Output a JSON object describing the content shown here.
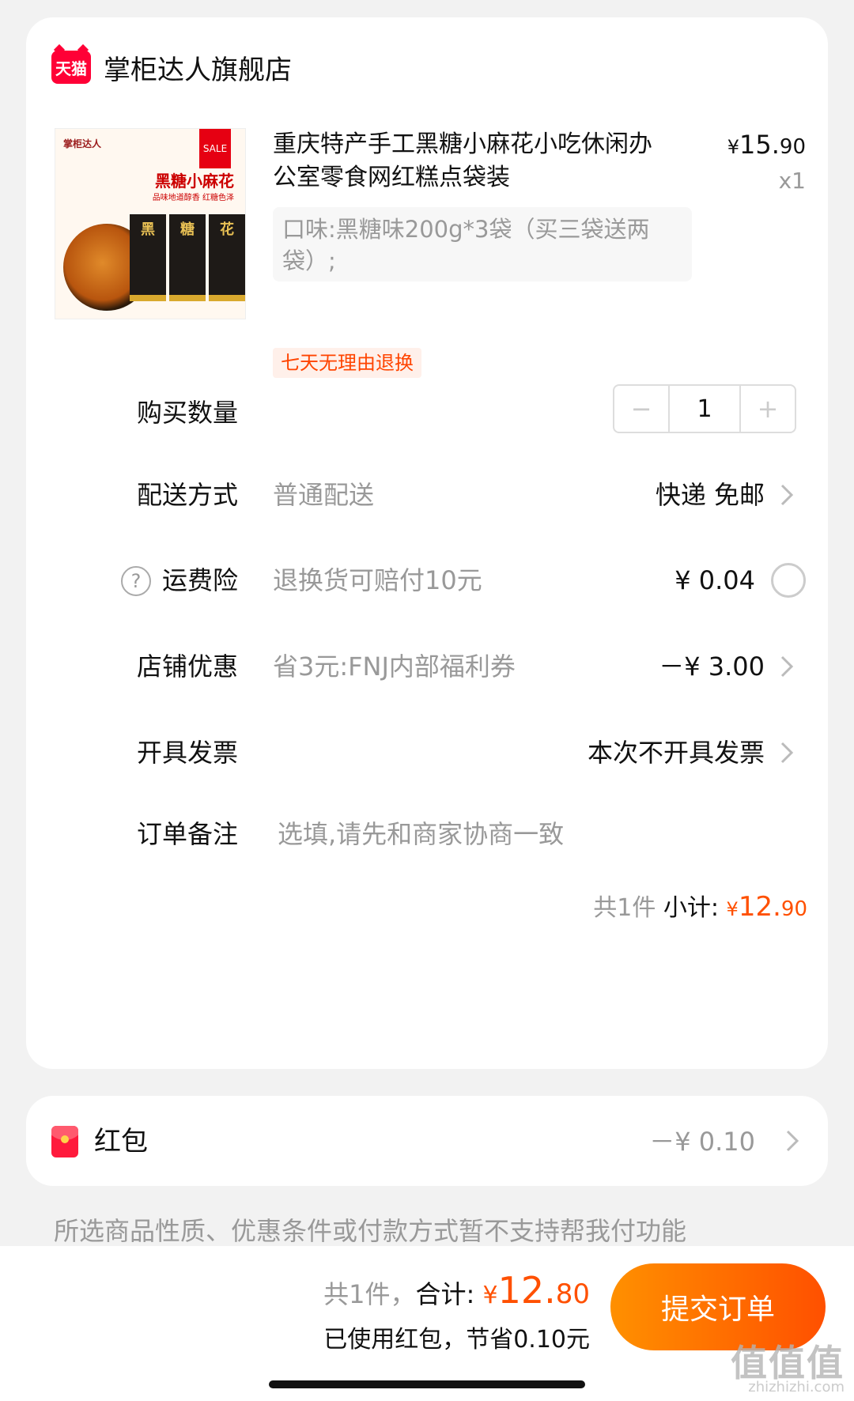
{
  "store": {
    "badge": "天猫",
    "name": "掌柜达人旗舰店"
  },
  "product": {
    "thumbnail": {
      "sale": "SALE",
      "title": "黑糖小麻花",
      "subtitle": "品味地道醇香 红糖色泽",
      "brand": "掌柜达人",
      "bag_chars": [
        "黑",
        "糖",
        "花"
      ]
    },
    "title": "重庆特产手工黑糖小麻花小吃休闲办公室零食网红糕点袋装",
    "price": {
      "currency": "¥",
      "integer": "15.",
      "decimal": "90"
    },
    "quantity_text": "x1",
    "variant": "口味:黑糖味200g*3袋（买三袋送两袋）;",
    "return_tag": "七天无理由退换"
  },
  "rows": {
    "quantity": {
      "label": "购买数量",
      "minus": "−",
      "value": "1",
      "plus": "+"
    },
    "delivery": {
      "label": "配送方式",
      "desc": "普通配送",
      "value": "快递 免邮"
    },
    "insurance": {
      "help": "?",
      "label": "运费险",
      "desc": "退换货可赔付10元",
      "value": "¥ 0.04"
    },
    "discount": {
      "label": "店铺优惠",
      "desc": "省3元:FNJ内部福利券",
      "value": "－¥ 3.00"
    },
    "invoice": {
      "label": "开具发票",
      "value": "本次不开具发票"
    },
    "remark": {
      "label": "订单备注",
      "placeholder": "选填,请先和商家协商一致"
    }
  },
  "subtotal": {
    "count": "共1件",
    "label": "小计:",
    "currency": "¥",
    "integer": "12.",
    "decimal": "90"
  },
  "red_packet": {
    "label": "红包",
    "value": "－¥ 0.10"
  },
  "notice": "所选商品性质、优惠条件或付款方式暂不支持帮我付功能",
  "footer": {
    "count": "共1件，",
    "total_label": "合计:",
    "currency": "¥",
    "integer": "12.",
    "decimal": "80",
    "saved": "已使用红包，节省0.10元",
    "submit": "提交订单",
    "watermark": "值值值",
    "watermark_url": "zhizhizhi.com"
  },
  "colors": {
    "accent": "#ff5000",
    "tmall_red": "#ff0036",
    "muted": "#999999"
  }
}
